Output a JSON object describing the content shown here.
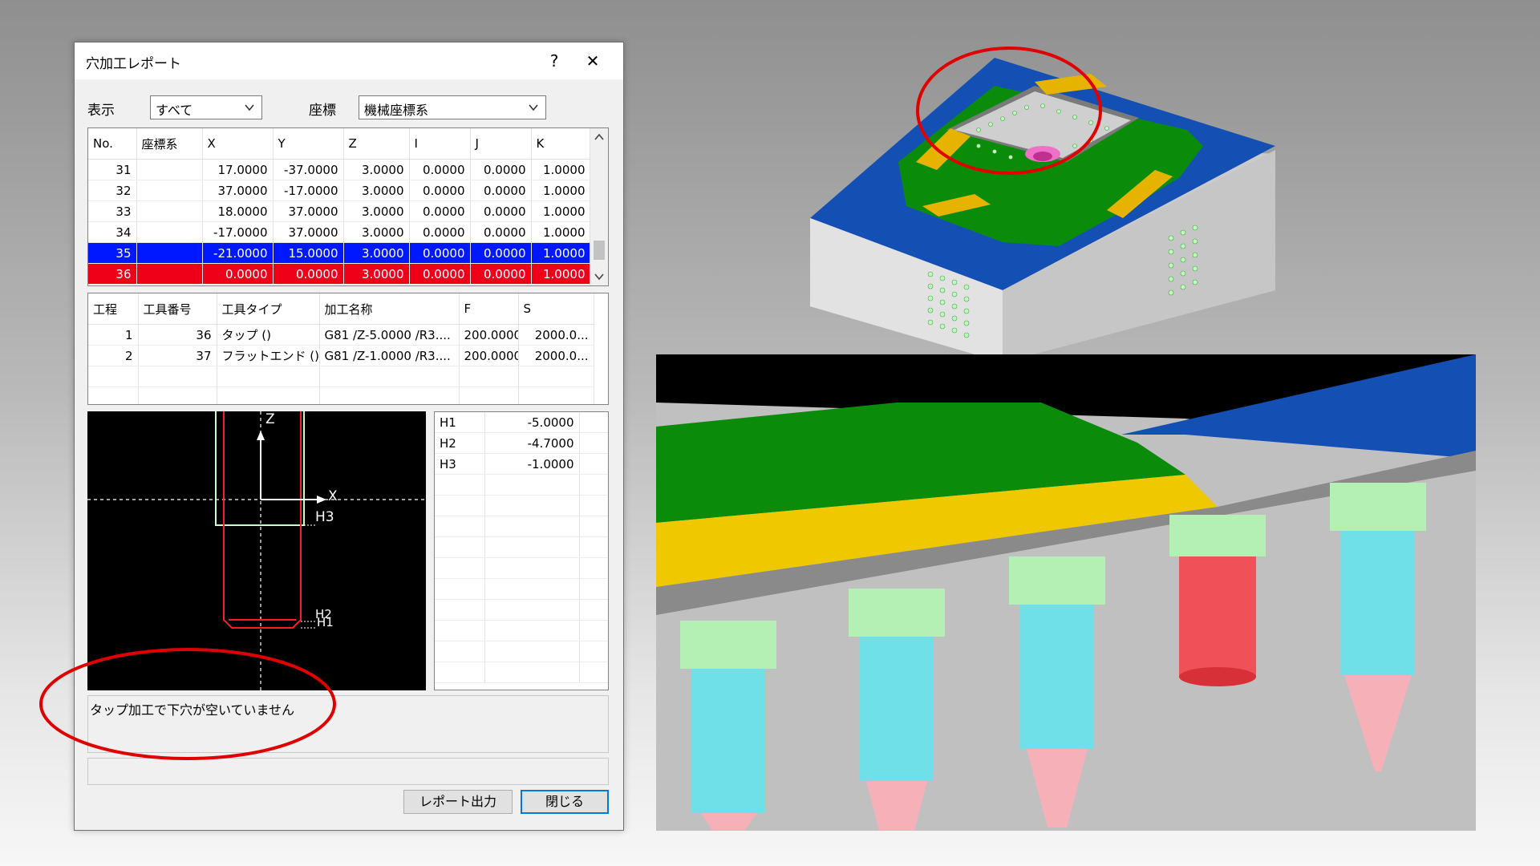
{
  "dialog": {
    "title": "穴加工レポート",
    "help": "?",
    "close": "✕",
    "filter": {
      "display_label": "表示",
      "display_value": "すべて",
      "coord_label": "座標",
      "coord_value": "機械座標系"
    },
    "points": {
      "columns": [
        "No.",
        "座標系",
        "X",
        "Y",
        "Z",
        "I",
        "J",
        "K"
      ],
      "rows": [
        [
          "31",
          "",
          "17.0000",
          "-37.0000",
          "3.0000",
          "0.0000",
          "0.0000",
          "1.0000"
        ],
        [
          "32",
          "",
          "37.0000",
          "-17.0000",
          "3.0000",
          "0.0000",
          "0.0000",
          "1.0000"
        ],
        [
          "33",
          "",
          "18.0000",
          "37.0000",
          "3.0000",
          "0.0000",
          "0.0000",
          "1.0000"
        ],
        [
          "34",
          "",
          "-17.0000",
          "37.0000",
          "3.0000",
          "0.0000",
          "0.0000",
          "1.0000"
        ],
        [
          "35",
          "",
          "-21.0000",
          "15.0000",
          "3.0000",
          "0.0000",
          "0.0000",
          "1.0000"
        ],
        [
          "36",
          "",
          "0.0000",
          "0.0000",
          "3.0000",
          "0.0000",
          "0.0000",
          "1.0000"
        ]
      ]
    },
    "process": {
      "columns": [
        "工程",
        "工具番号",
        "工具タイプ",
        "加工名称",
        "F",
        "S"
      ],
      "rows": [
        [
          "1",
          "36",
          "タップ ()",
          "G81 /Z-5.0000 /R3....",
          "200.0000",
          "2000.0..."
        ],
        [
          "2",
          "37",
          "フラットエンド ()",
          "G81 /Z-1.0000 /R3....",
          "200.0000",
          "2000.0..."
        ]
      ]
    },
    "preview": {
      "axis_z": "Z",
      "axis_x": "X",
      "h3": "H3",
      "h2": "H2",
      "h1": "H1"
    },
    "heights": [
      {
        "name": "H1",
        "value": "-5.0000"
      },
      {
        "name": "H2",
        "value": "-4.7000"
      },
      {
        "name": "H3",
        "value": "-1.0000"
      }
    ],
    "message": "タップ加工で下穴が空いていません",
    "buttons": {
      "report": "レポート出力",
      "close": "閉じる"
    }
  },
  "colors": {
    "highlight_blue": "#0018ff",
    "highlight_red": "#f00018",
    "annotation_red": "#e00000"
  }
}
